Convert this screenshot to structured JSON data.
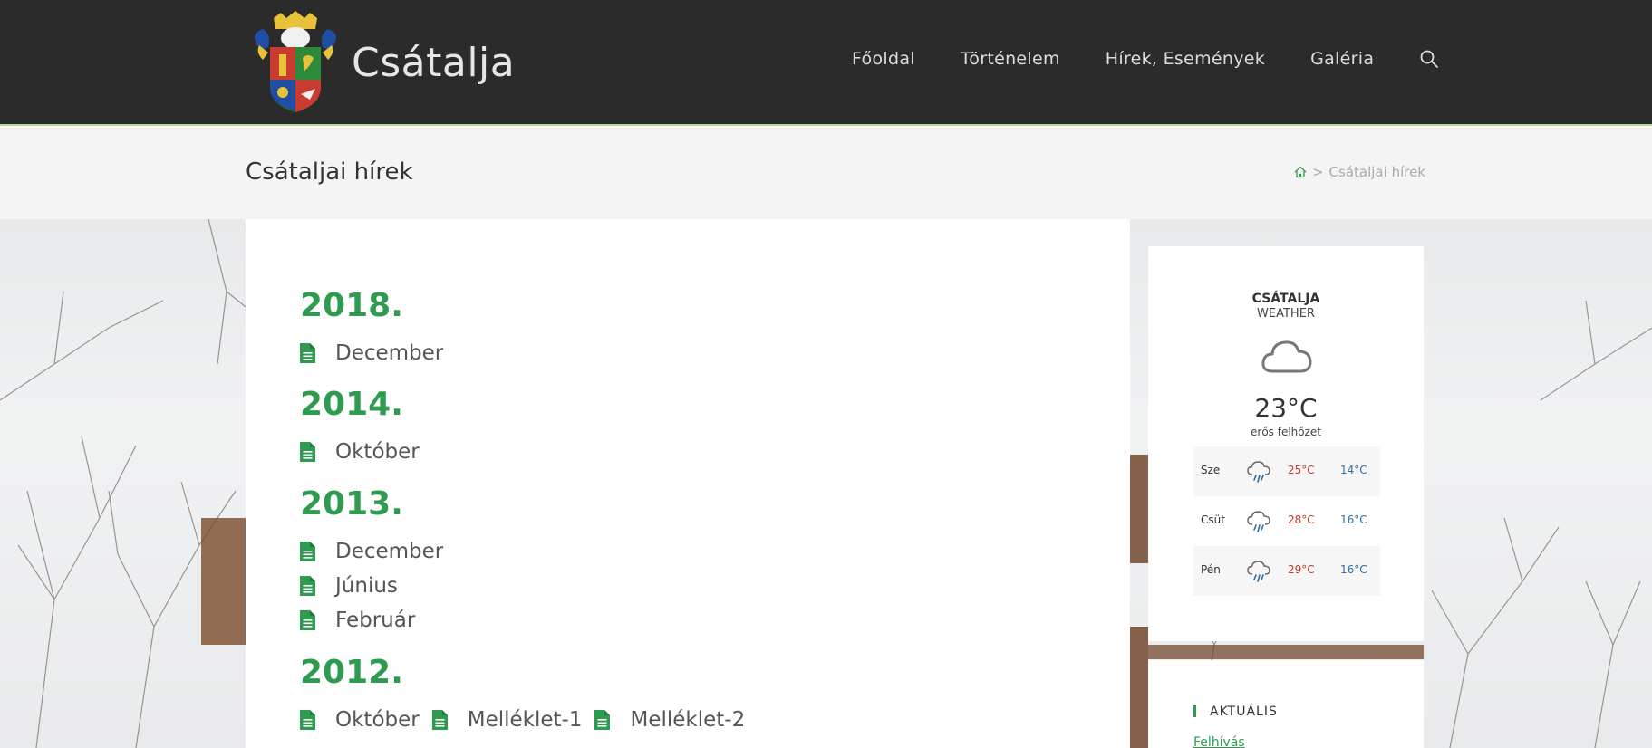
{
  "header": {
    "site_name": "Csátalja",
    "nav": [
      {
        "label": "Főoldal"
      },
      {
        "label": "Történelem"
      },
      {
        "label": "Hírek, Események"
      },
      {
        "label": "Galéria"
      }
    ],
    "search_icon": "search-icon"
  },
  "titlebar": {
    "title": "Csátaljai hírek",
    "breadcrumb_home_icon": "home-icon",
    "breadcrumb_separator": ">",
    "breadcrumb_current": "Csátaljai hírek"
  },
  "archive": [
    {
      "year": "2018.",
      "entries": [
        [
          "December"
        ]
      ]
    },
    {
      "year": "2014.",
      "entries": [
        [
          "Október"
        ]
      ]
    },
    {
      "year": "2013.",
      "entries": [
        [
          "December"
        ],
        [
          "Június"
        ],
        [
          "Február"
        ]
      ]
    },
    {
      "year": "2012.",
      "entries": [
        [
          "Október",
          "Melléklet-1",
          "Melléklet-2"
        ]
      ]
    }
  ],
  "weather": {
    "city": "CSÁTALJA",
    "subtitle": "WEATHER",
    "current_icon": "cloud-icon",
    "temperature": "23°C",
    "description": "erős felhőzet",
    "forecast": [
      {
        "day": "Sze",
        "icon": "rain-cloud-icon",
        "high": "25°C",
        "low": "14°C"
      },
      {
        "day": "Csüt",
        "icon": "rain-cloud-icon",
        "high": "28°C",
        "low": "16°C"
      },
      {
        "day": "Pén",
        "icon": "rain-cloud-icon",
        "high": "29°C",
        "low": "16°C"
      }
    ]
  },
  "aktualis": {
    "title": "AKTUÁLIS",
    "link": "Felhívás"
  },
  "colors": {
    "header_bg": "#2b2b2b",
    "accent_green": "#2e9b50",
    "high_temp": "#c0392b",
    "low_temp": "#2e6da4"
  }
}
